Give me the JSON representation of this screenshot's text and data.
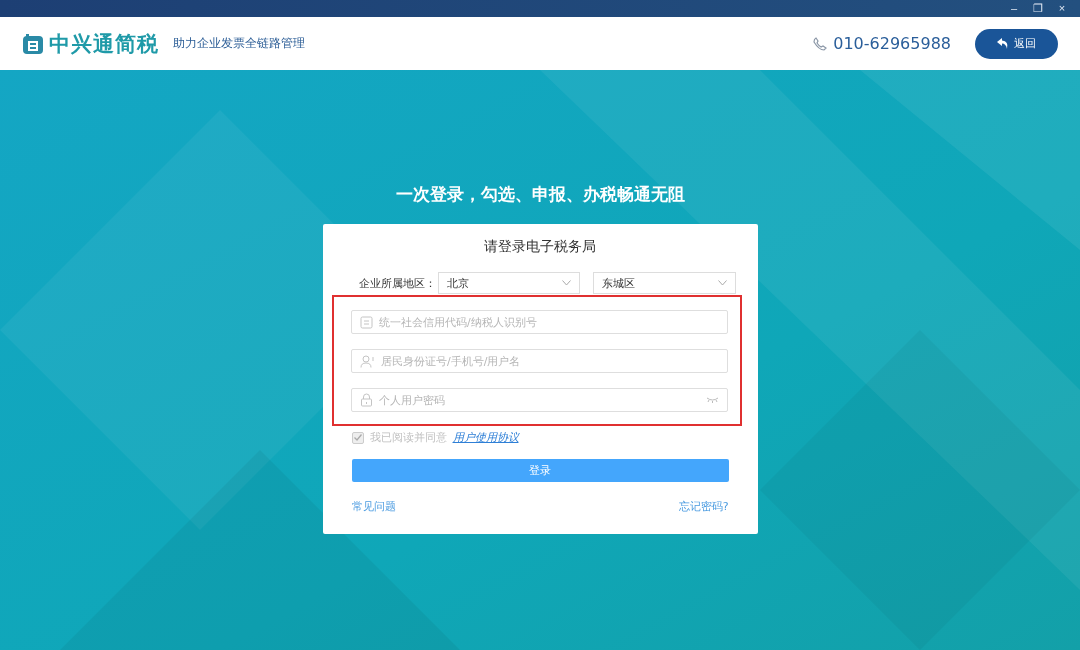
{
  "window": {
    "controls": [
      "–",
      "❐",
      "×"
    ]
  },
  "header": {
    "logo_text": "中兴通简税",
    "slogan": "助力企业发票全链路管理",
    "phone": "010-62965988",
    "back_button": "返回"
  },
  "headline": "一次登录，勾选、申报、办税畅通无阻",
  "login": {
    "title": "请登录电子税务局",
    "region_label": "企业所属地区：",
    "region_selects": [
      {
        "value": "北京"
      },
      {
        "value": "东城区"
      }
    ],
    "highlighted": true,
    "fields": [
      {
        "kind": "id",
        "placeholder": "统一社会信用代码/纳税人识别号"
      },
      {
        "kind": "user",
        "placeholder": "居民身份证号/手机号/用户名"
      },
      {
        "kind": "password",
        "placeholder": "个人用户密码"
      }
    ],
    "agreement": {
      "checked": true,
      "disabled": true,
      "text": "我已阅读并同意",
      "link": "用户使用协议"
    },
    "submit": "登录",
    "links": [
      "常见问题",
      "忘记密码?"
    ]
  }
}
